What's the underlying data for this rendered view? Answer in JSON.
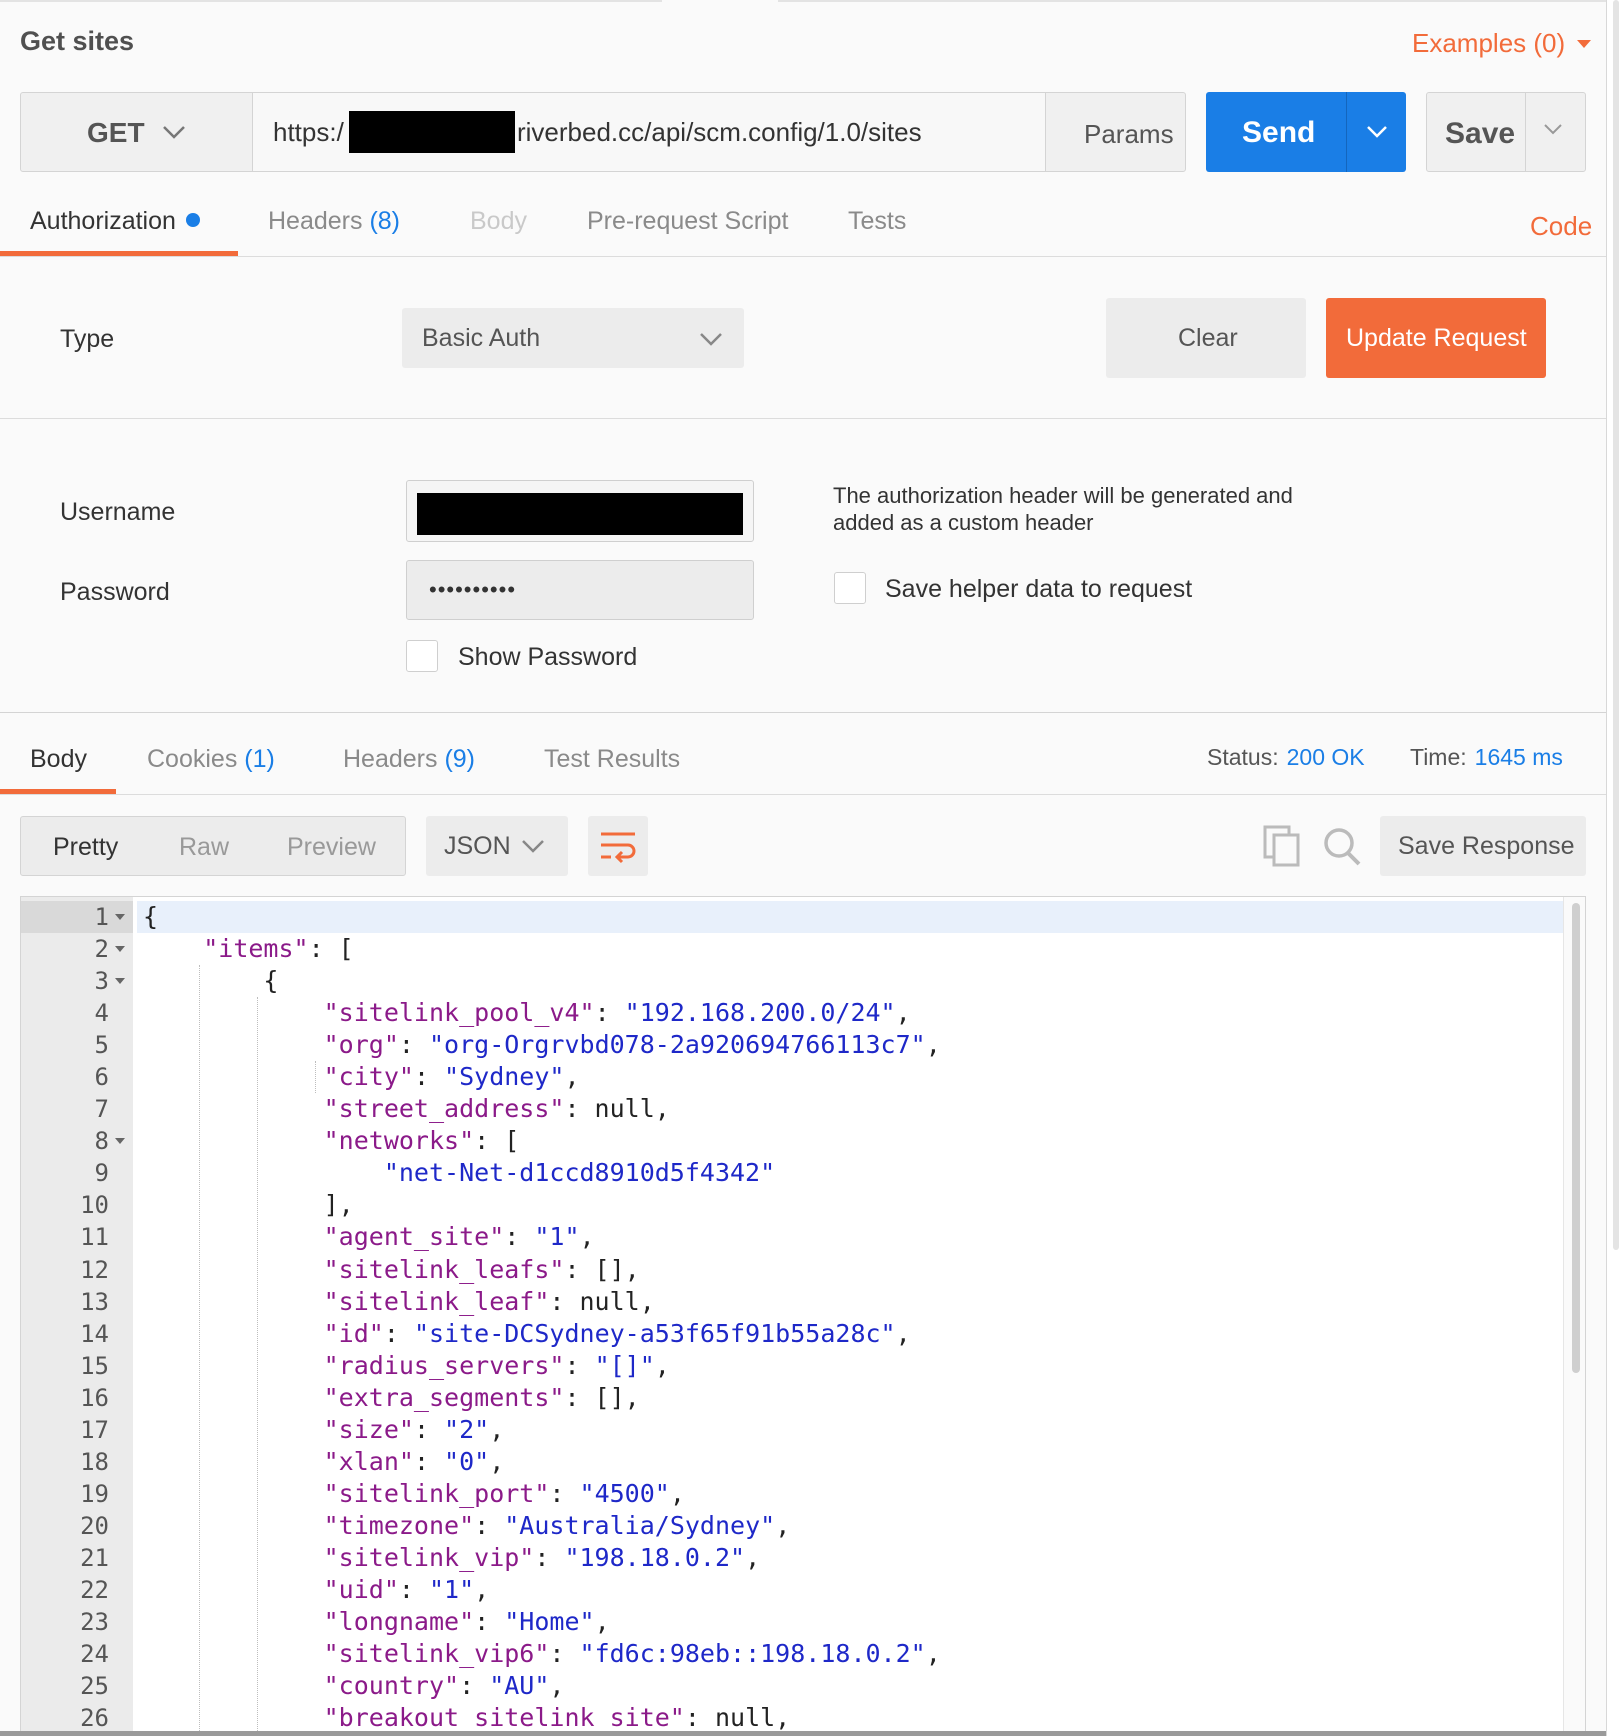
{
  "request": {
    "title": "Get sites",
    "examples_label": "Examples (0)",
    "method": "GET",
    "url_prefix": "https:/",
    "url_suffix": "riverbed.cc/api/scm.config/1.0/sites",
    "params_label": "Params",
    "send_label": "Send",
    "save_label": "Save"
  },
  "request_tabs": {
    "authorization": "Authorization",
    "headers_label": "Headers",
    "headers_count": "(8)",
    "body": "Body",
    "prerequest": "Pre-request Script",
    "tests": "Tests",
    "code": "Code"
  },
  "auth": {
    "type_label": "Type",
    "type_value": "Basic Auth",
    "clear_label": "Clear",
    "update_label": "Update Request",
    "username_label": "Username",
    "password_label": "Password",
    "password_mask": "••••••••••",
    "show_password_label": "Show Password",
    "note": "The authorization header will be generated and added as a custom header",
    "save_helper_label": "Save helper data to request"
  },
  "response_tabs": {
    "body": "Body",
    "cookies_label": "Cookies",
    "cookies_count": "(1)",
    "headers_label": "Headers",
    "headers_count": "(9)",
    "test_results": "Test Results",
    "status_label": "Status:",
    "status_value": "200 OK",
    "time_label": "Time:",
    "time_value": "1645 ms"
  },
  "response_toolbar": {
    "pretty": "Pretty",
    "raw": "Raw",
    "preview": "Preview",
    "format": "JSON",
    "save_response": "Save Response"
  },
  "icons": {
    "method_dropdown": "chevron-down-icon",
    "send_dropdown": "chevron-down-icon",
    "save_dropdown": "chevron-down-icon",
    "wrap": "wrap-lines-icon",
    "copy": "copy-icon",
    "search": "search-icon"
  },
  "colors": {
    "accent_orange": "#f26b3a",
    "accent_blue": "#1a7ee6",
    "json_key": "#8b1a89",
    "json_string": "#1e28c8"
  },
  "code_lines": [
    {
      "n": "1",
      "text": "{"
    },
    {
      "n": "2",
      "text": "    \"items\": ["
    },
    {
      "n": "3",
      "text": "        {"
    },
    {
      "n": "4",
      "text": "            \"sitelink_pool_v4\": \"192.168.200.0/24\","
    },
    {
      "n": "5",
      "text": "            \"org\": \"org-Orgrvbd078-2a920694766113c7\","
    },
    {
      "n": "6",
      "text": "            \"city\": \"Sydney\","
    },
    {
      "n": "7",
      "text": "            \"street_address\": null,"
    },
    {
      "n": "8",
      "text": "            \"networks\": ["
    },
    {
      "n": "9",
      "text": "                \"net-Net-d1ccd8910d5f4342\""
    },
    {
      "n": "10",
      "text": "            ],"
    },
    {
      "n": "11",
      "text": "            \"agent_site\": \"1\","
    },
    {
      "n": "12",
      "text": "            \"sitelink_leafs\": [],"
    },
    {
      "n": "13",
      "text": "            \"sitelink_leaf\": null,"
    },
    {
      "n": "14",
      "text": "            \"id\": \"site-DCSydney-a53f65f91b55a28c\","
    },
    {
      "n": "15",
      "text": "            \"radius_servers\": \"[]\","
    },
    {
      "n": "16",
      "text": "            \"extra_segments\": [],"
    },
    {
      "n": "17",
      "text": "            \"size\": \"2\","
    },
    {
      "n": "18",
      "text": "            \"xlan\": \"0\","
    },
    {
      "n": "19",
      "text": "            \"sitelink_port\": \"4500\","
    },
    {
      "n": "20",
      "text": "            \"timezone\": \"Australia/Sydney\","
    },
    {
      "n": "21",
      "text": "            \"sitelink_vip\": \"198.18.0.2\","
    },
    {
      "n": "22",
      "text": "            \"uid\": \"1\","
    },
    {
      "n": "23",
      "text": "            \"longname\": \"Home\","
    },
    {
      "n": "24",
      "text": "            \"sitelink_vip6\": \"fd6c:98eb::198.18.0.2\","
    },
    {
      "n": "25",
      "text": "            \"country\": \"AU\","
    },
    {
      "n": "26",
      "text": "            \"breakout_sitelink_site\": null,"
    }
  ]
}
